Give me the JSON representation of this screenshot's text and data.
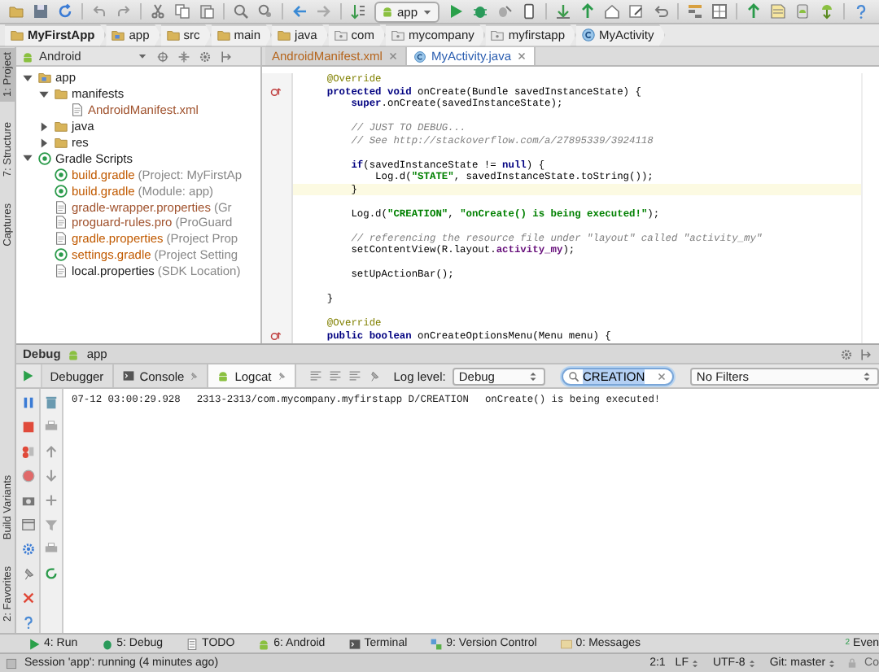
{
  "toolbar": {
    "run_config": "app"
  },
  "breadcrumbs": [
    {
      "label": "MyFirstApp",
      "kind": "folder"
    },
    {
      "label": "app",
      "kind": "module"
    },
    {
      "label": "src",
      "kind": "folder"
    },
    {
      "label": "main",
      "kind": "folder"
    },
    {
      "label": "java",
      "kind": "folder"
    },
    {
      "label": "com",
      "kind": "package"
    },
    {
      "label": "mycompany",
      "kind": "package"
    },
    {
      "label": "myfirstapp",
      "kind": "package"
    },
    {
      "label": "MyActivity",
      "kind": "class"
    }
  ],
  "left_stripe": {
    "top": [
      {
        "label": "1: Project",
        "selected": true
      },
      {
        "label": "7: Structure",
        "selected": false
      },
      {
        "label": "Captures",
        "selected": false
      }
    ],
    "bottom": [
      {
        "label": "Build Variants",
        "selected": false
      },
      {
        "label": "2: Favorites",
        "selected": false
      }
    ]
  },
  "project": {
    "view": "Android",
    "tree": [
      {
        "label": "app",
        "kind": "module",
        "expanded": true,
        "children": [
          {
            "label": "manifests",
            "kind": "folder",
            "expanded": true,
            "children": [
              {
                "label": "AndroidManifest.xml",
                "kind": "file",
                "color": "#a0522d"
              }
            ]
          },
          {
            "label": "java",
            "kind": "folder",
            "expanded": false
          },
          {
            "label": "res",
            "kind": "folder",
            "expanded": false
          }
        ]
      },
      {
        "label": "Gradle Scripts",
        "kind": "gradle",
        "expanded": true,
        "children": [
          {
            "label": "build.gradle",
            "detail": "(Project: MyFirstAp",
            "kind": "gradle",
            "color": "#c15a00"
          },
          {
            "label": "build.gradle",
            "detail": "(Module: app)",
            "kind": "gradle",
            "color": "#c15a00"
          },
          {
            "label": "gradle-wrapper.properties",
            "detail": "(Gr",
            "kind": "file",
            "color": "#a0522d"
          },
          {
            "label": "proguard-rules.pro",
            "detail": "(ProGuard",
            "kind": "file",
            "color": "#a0522d"
          },
          {
            "label": "gradle.properties",
            "detail": "(Project Prop",
            "kind": "file",
            "color": "#c15a00"
          },
          {
            "label": "settings.gradle",
            "detail": "(Project Setting",
            "kind": "gradle",
            "color": "#c15a00"
          },
          {
            "label": "local.properties",
            "detail": "(SDK Location)",
            "kind": "file",
            "color": "#202020"
          }
        ]
      }
    ]
  },
  "editor": {
    "tabs": [
      {
        "label": "AndroidManifest.xml",
        "selected": false,
        "color": "#b5651d"
      },
      {
        "label": "MyActivity.java",
        "selected": true,
        "color": "#2a5db0"
      }
    ],
    "blocks": [
      [
        {
          "highlighted": false,
          "overrides": false,
          "segments": [
            {
              "kind": "annotation",
              "text": "    @Override"
            }
          ]
        },
        {
          "highlighted": false,
          "overrides": true,
          "segments": [
            {
              "kind": "keyword",
              "text": "    protected void"
            },
            {
              "kind": "plain",
              "text": " onCreate(Bundle savedInstanceState) {"
            }
          ]
        },
        {
          "highlighted": false,
          "overrides": false,
          "segments": [
            {
              "kind": "keyword",
              "text": "        super"
            },
            {
              "kind": "plain",
              "text": ".onCreate(savedInstanceState);"
            }
          ]
        }
      ],
      [
        {
          "highlighted": false,
          "overrides": false,
          "segments": [
            {
              "kind": "comment",
              "text": "        // JUST TO DEBUG..."
            }
          ]
        },
        {
          "highlighted": false,
          "overrides": false,
          "segments": [
            {
              "kind": "comment",
              "text": "        // See http://stackoverflow.com/a/27895339/3924118"
            }
          ]
        }
      ],
      [
        {
          "highlighted": false,
          "overrides": false,
          "segments": [
            {
              "kind": "keyword",
              "text": "        if"
            },
            {
              "kind": "plain",
              "text": "(savedInstanceState != "
            },
            {
              "kind": "keyword",
              "text": "null"
            },
            {
              "kind": "plain",
              "text": ") {"
            }
          ]
        },
        {
          "highlighted": false,
          "overrides": false,
          "segments": [
            {
              "kind": "plain",
              "text": "            Log.d("
            },
            {
              "kind": "string",
              "text": "\"STATE\""
            },
            {
              "kind": "plain",
              "text": ", savedInstanceState.toString());"
            }
          ]
        },
        {
          "highlighted": true,
          "overrides": false,
          "segments": [
            {
              "kind": "plain",
              "text": "        }"
            }
          ]
        }
      ],
      [
        {
          "highlighted": false,
          "overrides": false,
          "segments": [
            {
              "kind": "plain",
              "text": "        Log.d("
            },
            {
              "kind": "string",
              "text": "\"CREATION\""
            },
            {
              "kind": "plain",
              "text": ", "
            },
            {
              "kind": "string",
              "text": "\"onCreate() is being executed!\""
            },
            {
              "kind": "plain",
              "text": ");"
            }
          ]
        }
      ],
      [
        {
          "highlighted": false,
          "overrides": false,
          "segments": [
            {
              "kind": "comment",
              "text": "        // referencing the resource file under \"layout\" called \"activity_my\""
            }
          ]
        },
        {
          "highlighted": false,
          "overrides": false,
          "segments": [
            {
              "kind": "plain",
              "text": "        setContentView(R.layout."
            },
            {
              "kind": "field",
              "text": "activity_my"
            },
            {
              "kind": "plain",
              "text": ");"
            }
          ]
        }
      ],
      [
        {
          "highlighted": false,
          "overrides": false,
          "segments": [
            {
              "kind": "plain",
              "text": "        setUpActionBar();"
            }
          ]
        }
      ],
      [
        {
          "highlighted": false,
          "overrides": false,
          "segments": [
            {
              "kind": "plain",
              "text": "    }"
            }
          ]
        }
      ],
      [
        {
          "highlighted": false,
          "overrides": false,
          "segments": [
            {
              "kind": "annotation",
              "text": "    @Override"
            }
          ]
        },
        {
          "highlighted": false,
          "overrides": true,
          "segments": [
            {
              "kind": "keyword",
              "text": "    public boolean"
            },
            {
              "kind": "plain",
              "text": " onCreateOptionsMenu(Menu menu) {"
            }
          ]
        }
      ]
    ]
  },
  "debug": {
    "title": "Debug",
    "config": "app",
    "tabs": [
      {
        "label": "Debugger",
        "selected": false
      },
      {
        "label": "Console",
        "selected": false
      },
      {
        "label": "Logcat",
        "selected": true
      }
    ],
    "log_level_label": "Log level:",
    "log_level": "Debug",
    "search": "CREATION",
    "filter": "No Filters",
    "log": [
      {
        "time": "07-12 03:00:29.928",
        "source": "2313-2313/com.mycompany.myfirstapp D/CREATION",
        "message": "onCreate() is being executed!"
      }
    ]
  },
  "bottom_tabs": {
    "left": [
      {
        "label": "4: Run",
        "kind": "run"
      },
      {
        "label": "5: Debug",
        "kind": "debug"
      },
      {
        "label": "TODO",
        "kind": "todo"
      },
      {
        "label": "6: Android",
        "kind": "android"
      },
      {
        "label": "Terminal",
        "kind": "terminal"
      },
      {
        "label": "9: Version Control",
        "kind": "vcs"
      },
      {
        "label": "0: Messages",
        "kind": "messages"
      }
    ],
    "right": [
      {
        "label": "Even",
        "badge": "2"
      }
    ]
  },
  "status_bar": {
    "message": "Session 'app': running (4 minutes ago)",
    "position": "2:1",
    "line_ending": "LF",
    "encoding": "UTF-8",
    "vcs": "Git: master",
    "extra": "Co"
  }
}
